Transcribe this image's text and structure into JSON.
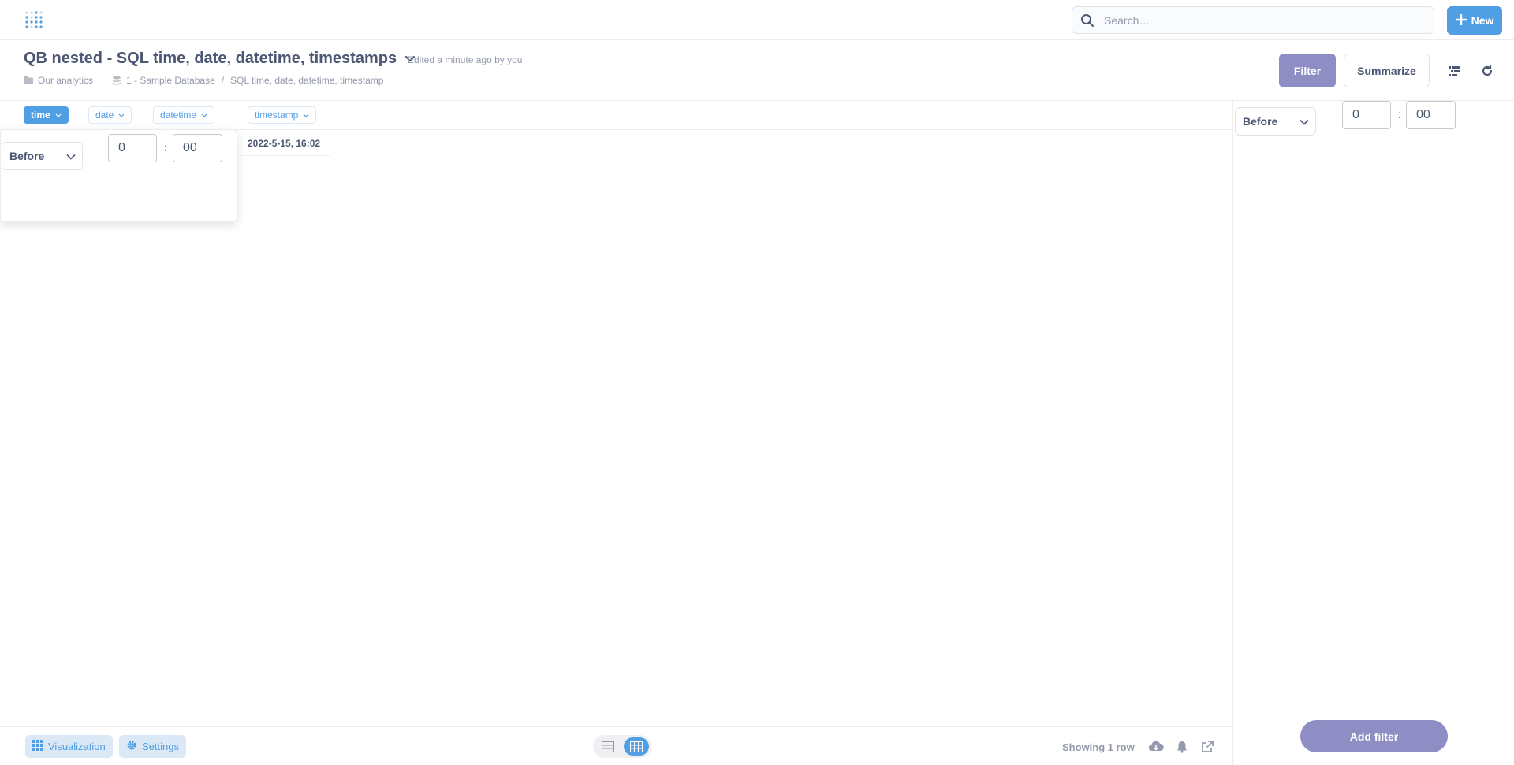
{
  "nav": {
    "search_placeholder": "Search…",
    "new_label": "New"
  },
  "header": {
    "title": "QB nested - SQL time, date, datetime, timestamps",
    "edited": "Edited a minute ago by you",
    "collection": "Our analytics",
    "database": "1 - Sample Database",
    "table": "SQL time, date, datetime, timestamp",
    "filter_label": "Filter",
    "summarize_label": "Summarize"
  },
  "columns": [
    {
      "label": "time",
      "active": true
    },
    {
      "label": "date",
      "active": false
    },
    {
      "label": "datetime",
      "active": false
    },
    {
      "label": "timestamp",
      "active": false
    }
  ],
  "rows": [
    {
      "timestamp": "2022-5-15, 16:02"
    }
  ],
  "popover": {
    "operator": "Before",
    "hours": "0",
    "colon": ":",
    "minutes": "00"
  },
  "sidebar": {
    "operator": "Before",
    "hours": "0",
    "colon": ":",
    "minutes": "00",
    "add_filter_label": "Add filter"
  },
  "footer": {
    "visualization_label": "Visualization",
    "settings_label": "Settings",
    "row_count": "Showing 1 row"
  },
  "colors": {
    "brand": "#509ee3",
    "filter": "#8e8ec4",
    "text": "#4c5773",
    "muted": "#949aab"
  }
}
